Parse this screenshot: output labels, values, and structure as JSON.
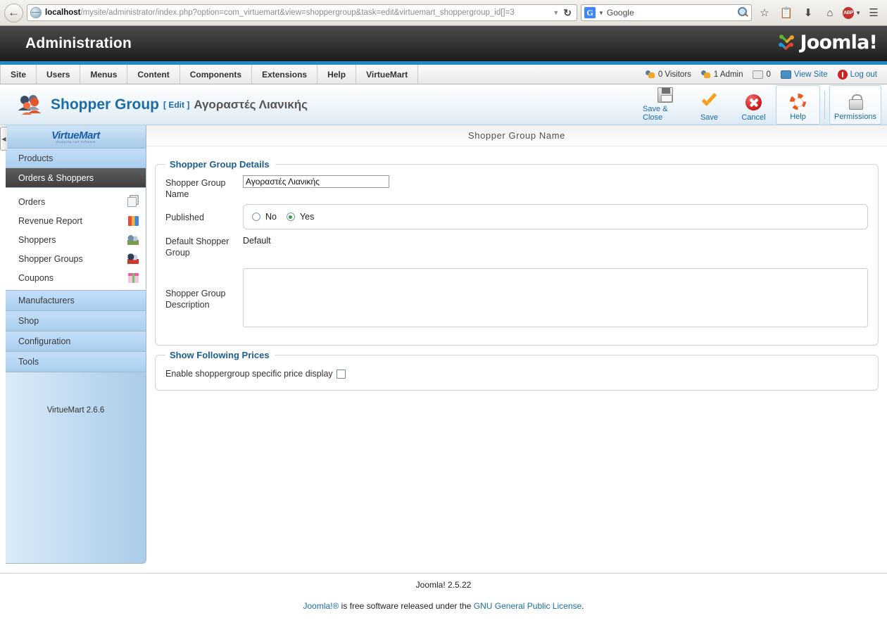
{
  "browser": {
    "back_icon": "back-arrow-icon",
    "url_host": "localhost",
    "url_path": "/mysite/administrator/index.php?option=com_virtuemart&view=shoppergroup&task=edit&virtuemart_shoppergroup_id[]=3",
    "url_dropdown_icon": "chevron-down-icon",
    "reload_icon": "reload-icon",
    "search_engine": "G",
    "search_placeholder": "Google",
    "search_magnify_icon": "magnifier-icon",
    "toolbar_icons": [
      "bookmark-star-icon",
      "reader-list-icon",
      "downloads-icon",
      "home-icon",
      "adblock-icon",
      "menu-hamburger-icon"
    ],
    "adblock_label": "ABP"
  },
  "admin_header": {
    "title": "Administration",
    "brand": "Joomla!",
    "accent_color": "#1e8bc3"
  },
  "menubar": {
    "items": [
      {
        "label": "Site"
      },
      {
        "label": "Users"
      },
      {
        "label": "Menus"
      },
      {
        "label": "Content"
      },
      {
        "label": "Components"
      },
      {
        "label": "Extensions"
      },
      {
        "label": "Help"
      },
      {
        "label": "VirtueMart"
      }
    ],
    "status": {
      "visitors": "0 Visitors",
      "admins": "1 Admin",
      "messages": "0",
      "view_site": "View Site",
      "logout": "Log out"
    }
  },
  "page_toolbar": {
    "icon": "shopper-group-icon",
    "title": "Shopper Group",
    "edit_tag": "[ Edit ]",
    "subject": "Αγοραστές Λιανικής",
    "buttons": [
      {
        "label": "Save & Close",
        "icon": "floppy-disk-icon"
      },
      {
        "label": "Save",
        "icon": "checkmark-icon"
      },
      {
        "label": "Cancel",
        "icon": "red-x-circle-icon"
      },
      {
        "label": "Help",
        "icon": "lifebuoy-icon"
      },
      {
        "label": "Permissions",
        "icon": "padlock-icon"
      }
    ]
  },
  "sidebar": {
    "collapse_icon": "collapse-left-icon",
    "logo": {
      "part1": "V",
      "part2": "irtue",
      "part3": "Mart",
      "tagline": "shopping cart software"
    },
    "top_items": [
      {
        "label": "Products",
        "active": false
      },
      {
        "label": "Orders & Shoppers",
        "active": true
      }
    ],
    "sub_items": [
      {
        "label": "Orders",
        "icon": "orders-icon"
      },
      {
        "label": "Revenue Report",
        "icon": "bar-chart-icon"
      },
      {
        "label": "Shoppers",
        "icon": "shoppers-icon"
      },
      {
        "label": "Shopper Groups",
        "icon": "shopper-groups-icon"
      },
      {
        "label": "Coupons",
        "icon": "gift-coupon-icon"
      }
    ],
    "bottom_items": [
      {
        "label": "Manufacturers"
      },
      {
        "label": "Shop"
      },
      {
        "label": "Configuration"
      },
      {
        "label": "Tools"
      }
    ],
    "version": "VirtueMart 2.6.6"
  },
  "content": {
    "heading": "Shopper Group Name",
    "panels": [
      {
        "legend": "Shopper Group Details",
        "fields": [
          {
            "label": "Shopper Group Name",
            "type": "text",
            "value": "Αγοραστές Λιανικής",
            "placeholder": ""
          },
          {
            "label": "Published",
            "type": "radio",
            "options": [
              "No",
              "Yes"
            ],
            "selected": "Yes"
          },
          {
            "label": "Default Shopper Group",
            "type": "static",
            "value": "Default"
          },
          {
            "label": "Shopper Group Description",
            "type": "textarea",
            "value": "",
            "placeholder": ""
          }
        ]
      },
      {
        "legend": "Show Following Prices",
        "checkbox_label": "Enable shoppergroup specific price display",
        "checkbox_checked": false
      }
    ]
  },
  "footer": {
    "version": "Joomla! 2.5.22",
    "credit_prefix": "Joomla!®",
    "credit_mid": " is free software released under the ",
    "credit_link": "GNU General Public License",
    "credit_suffix": "."
  }
}
